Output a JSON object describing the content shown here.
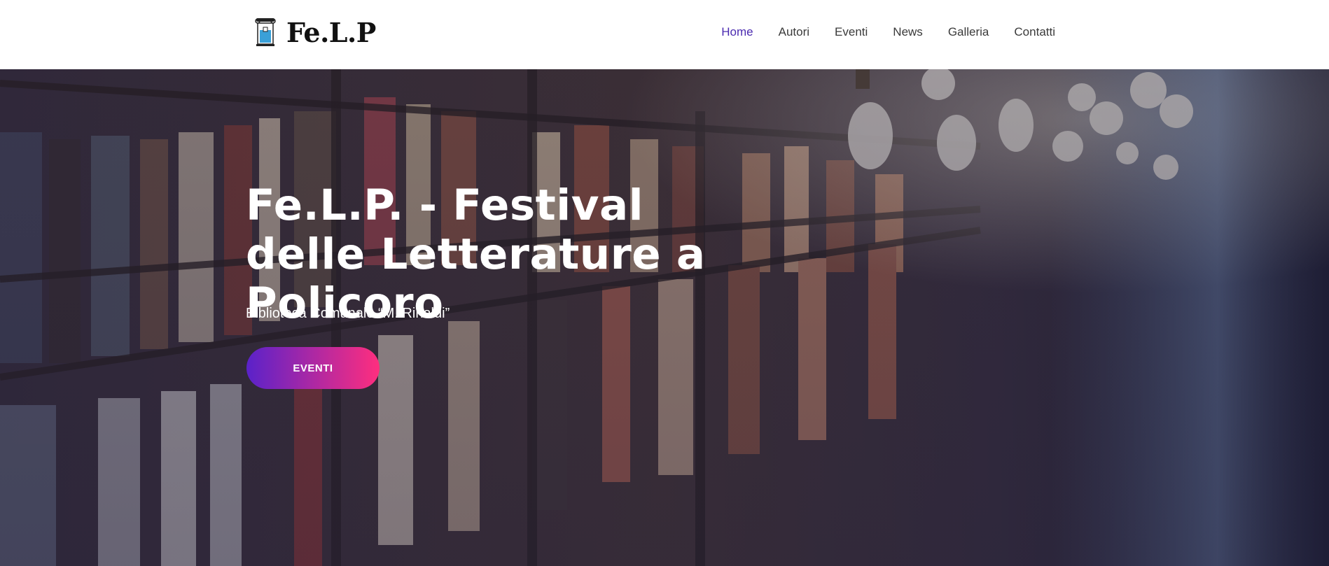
{
  "header": {
    "logo_text": "Fe.L.P",
    "logo_icon": "ionic-column-book-icon"
  },
  "nav": {
    "items": [
      {
        "label": "Home",
        "active": true
      },
      {
        "label": "Autori",
        "active": false
      },
      {
        "label": "Eventi",
        "active": false
      },
      {
        "label": "News",
        "active": false
      },
      {
        "label": "Galleria",
        "active": false
      },
      {
        "label": "Contatti",
        "active": false
      }
    ]
  },
  "hero": {
    "title": "Fe.L.P. - Festival delle Letterature a Policoro",
    "subtitle": "Biblioteca Comunale “M. Rinaldi”",
    "button_label": "EVENTI",
    "background": "library-bookshelves-photo"
  },
  "colors": {
    "nav_active": "#4b2bb0",
    "nav_text": "#3a3a3a",
    "button_gradient_start": "#5a22c9",
    "button_gradient_end": "#ff2e7e"
  }
}
